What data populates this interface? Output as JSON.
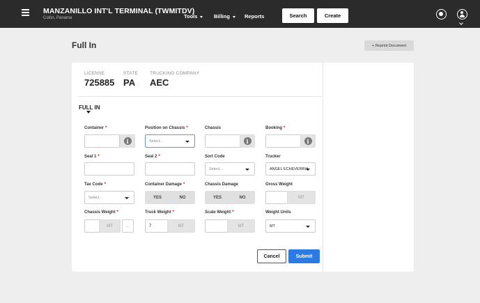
{
  "header": {
    "title": "MANZANILLO INT'L TERMINAL (TWMITDV)",
    "subtitle": "Colón, Panama",
    "nav": {
      "tools": "Tools",
      "billing": "Billing",
      "reports": "Reports"
    },
    "search_label": "Search",
    "create_label": "Create"
  },
  "page": {
    "title": "Full In",
    "reprint_label": "+ Reprint Document"
  },
  "info": {
    "license_label": "LICENSE",
    "license_value": "725885",
    "state_label": "STATE",
    "state_value": "PA",
    "trucking_label": "TRUCKING COMPANY",
    "trucking_value": "AEC"
  },
  "section": {
    "title": "FULL IN"
  },
  "form": {
    "container_label": "Container",
    "position_label": "Position on Chassis",
    "position_placeholder": "Select...",
    "chassis_label": "Chassis",
    "booking_label": "Booking",
    "seal1_label": "Seal 1",
    "seal2_label": "Seal 2",
    "sort_code_label": "Sort Code",
    "sort_code_placeholder": "Select...",
    "trucker_label": "Trucker",
    "trucker_value": "ANGEL ECHEVERRIA",
    "tax_code_label": "Tax Code",
    "tax_code_placeholder": "Select...",
    "container_damage_label": "Container Damage",
    "chassis_damage_label": "Chassis Damage",
    "yes": "YES",
    "no": "NO",
    "gross_weight_label": "Gross Weight",
    "chassis_weight_label": "Chassis Weight",
    "truck_weight_label": "Truck Weight",
    "truck_weight_value": "7",
    "scale_weight_label": "Scale Weight",
    "weight_units_label": "Weight Units",
    "weight_units_value": "MT",
    "unit_mt": "MT",
    "dots": "...",
    "required_mark": "*",
    "info_glyph": "i"
  },
  "actions": {
    "cancel_label": "Cancel",
    "submit_label": "Submit"
  },
  "colors": {
    "topbar": "#2b2b2b",
    "primary": "#2c7be5",
    "required": "#e00000"
  },
  "icons": [
    "menu-icon",
    "settings-icon",
    "user-icon",
    "info-icon",
    "chevron-down-icon"
  ]
}
